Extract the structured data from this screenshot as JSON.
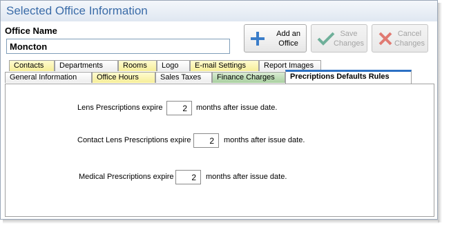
{
  "window": {
    "title": "Selected Office Information"
  },
  "office": {
    "label": "Office Name",
    "value": "Moncton"
  },
  "buttons": {
    "add": {
      "line1": "Add an",
      "line2": "Office",
      "icon": "plus-icon",
      "color": "#3a7dc9"
    },
    "save": {
      "line1": "Save",
      "line2": "Changes",
      "icon": "check-icon",
      "color": "#6fb09a"
    },
    "cancel": {
      "line1": "Cancel",
      "line2": "Changes",
      "icon": "x-icon",
      "color": "#e07a72"
    }
  },
  "tabs_back": [
    "Contacts",
    "Departments",
    "Rooms",
    "Logo",
    "E-mail Settings",
    "Report Images"
  ],
  "tabs_front": [
    "General Information",
    "Office Hours",
    "Sales Taxes",
    "Finance Charges",
    "Precriptions Defaults Rules"
  ],
  "active_tab": "Precriptions Defaults Rules",
  "rules": [
    {
      "before": "Lens Prescriptions expire",
      "value": "2",
      "after": "months after issue date."
    },
    {
      "before": "Contact Lens Prescriptions expire",
      "value": "2",
      "after": "months after issue date."
    },
    {
      "before": "Medical Prescriptions expire",
      "value": "2",
      "after": "months after issue date."
    }
  ]
}
